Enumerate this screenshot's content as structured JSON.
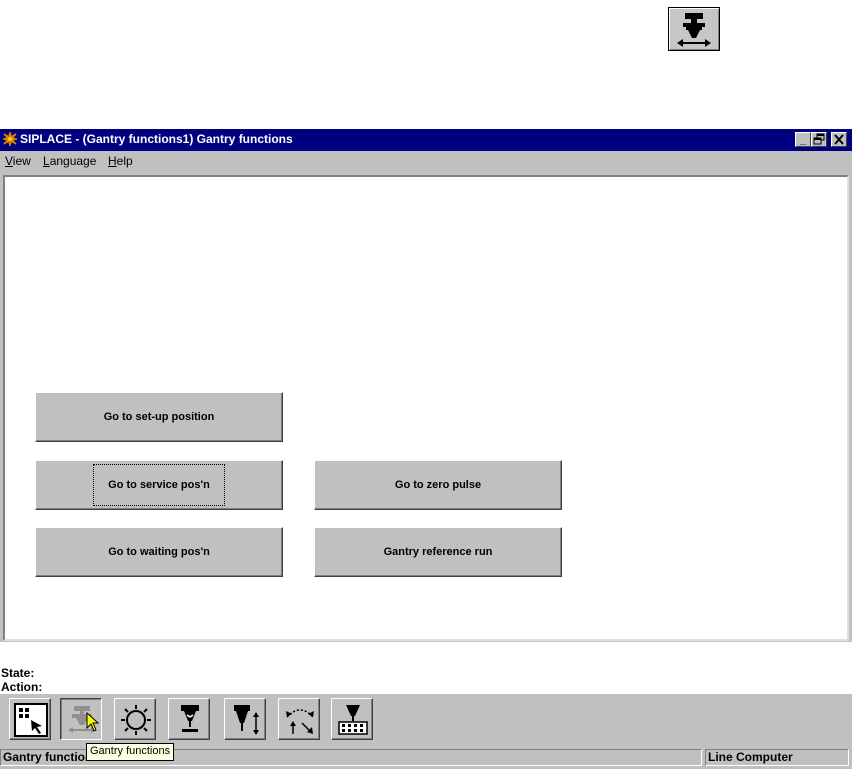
{
  "window": {
    "title": "SIPLACE - (Gantry functions1) Gantry functions",
    "minimize": "_",
    "restore": "🗗",
    "close": "✕"
  },
  "menu": [
    {
      "label": "View",
      "accel": "V"
    },
    {
      "label": "Language",
      "accel": "L"
    },
    {
      "label": "Help",
      "accel": "H"
    }
  ],
  "buttons": {
    "setup": "Go to set-up position",
    "service": "Go to service pos'n",
    "zero": "Go to zero pulse",
    "waiting": "Go to waiting pos'n",
    "reference": "Gantry reference run"
  },
  "state": {
    "state_label": "State:",
    "action_label": "Action:"
  },
  "toolbar": {
    "icons": [
      "select-pointer-icon",
      "gantry-functions-icon",
      "nozzle-ring-icon",
      "pipette-icon",
      "pipette-z-axis-icon",
      "rotation-axis-icon",
      "component-tray-icon"
    ]
  },
  "tooltip": "Gantry functions",
  "status": {
    "left": "Gantry functions",
    "right": "Line Computer"
  },
  "colors": {
    "titlebar": "#000080",
    "face": "#c0c0c0",
    "tooltip_bg": "#ffffe1"
  }
}
